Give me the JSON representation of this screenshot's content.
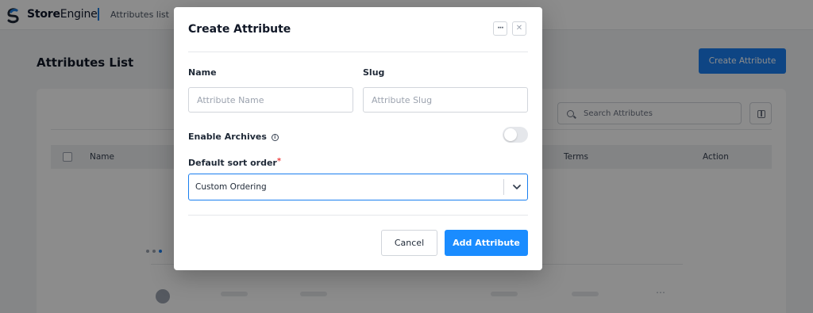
{
  "app": {
    "brand_bold": "Store",
    "brand_light": "Engine",
    "breadcrumb": "Attributes list"
  },
  "page": {
    "title": "Attributes List",
    "create_button_label": "Create Attribute",
    "search_placeholder": "Search Attributes",
    "columns": [
      "Name",
      "Terms",
      "Action"
    ]
  },
  "modal": {
    "title": "Create Attribute",
    "name_label": "Name",
    "name_placeholder": "Attribute Name",
    "slug_label": "Slug",
    "slug_placeholder": "Attribute Slug",
    "enable_archives_label": "Enable Archives",
    "enable_archives_on": false,
    "sort_label": "Default sort order",
    "required_mark": "*",
    "sort_value": "Custom Ordering",
    "cancel_label": "Cancel",
    "add_label": "Add Attribute"
  },
  "colors": {
    "primary": "#1a8cff",
    "required": "#ef4444"
  }
}
